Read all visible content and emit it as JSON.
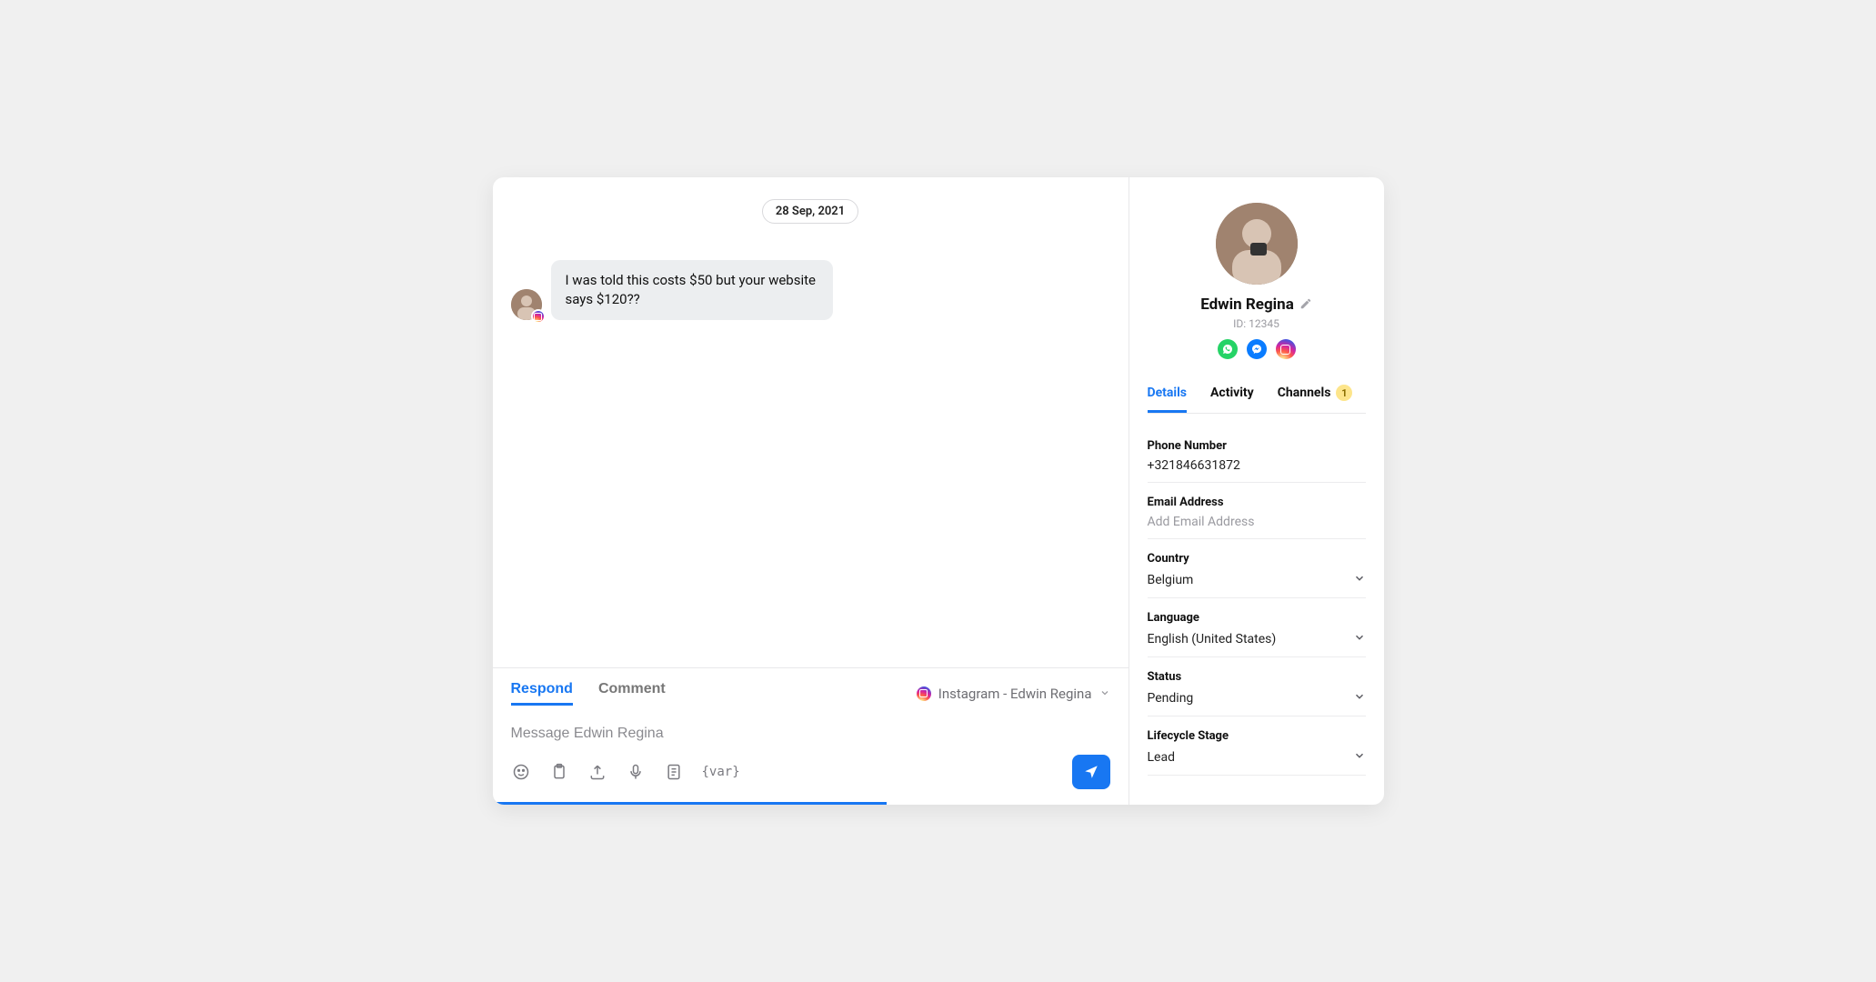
{
  "conversation": {
    "date": "28 Sep, 2021",
    "message": "I was told this costs $50 but your website says $120??"
  },
  "composer": {
    "tabs": {
      "respond": "Respond",
      "comment": "Comment"
    },
    "channel_label": "Instagram - Edwin Regina",
    "placeholder": "Message Edwin Regina",
    "var_label": "{var}"
  },
  "contact": {
    "name": "Edwin Regina",
    "id_label": "ID: 12345",
    "tabs": {
      "details": "Details",
      "activity": "Activity",
      "channels": "Channels",
      "channels_badge": "1"
    },
    "fields": {
      "phone": {
        "label": "Phone Number",
        "value": "+321846631872"
      },
      "email": {
        "label": "Email Address",
        "placeholder": "Add Email Address"
      },
      "country": {
        "label": "Country",
        "value": "Belgium"
      },
      "language": {
        "label": "Language",
        "value": "English (United States)"
      },
      "status": {
        "label": "Status",
        "value": "Pending"
      },
      "lifecycle": {
        "label": "Lifecycle Stage",
        "value": "Lead"
      }
    }
  }
}
